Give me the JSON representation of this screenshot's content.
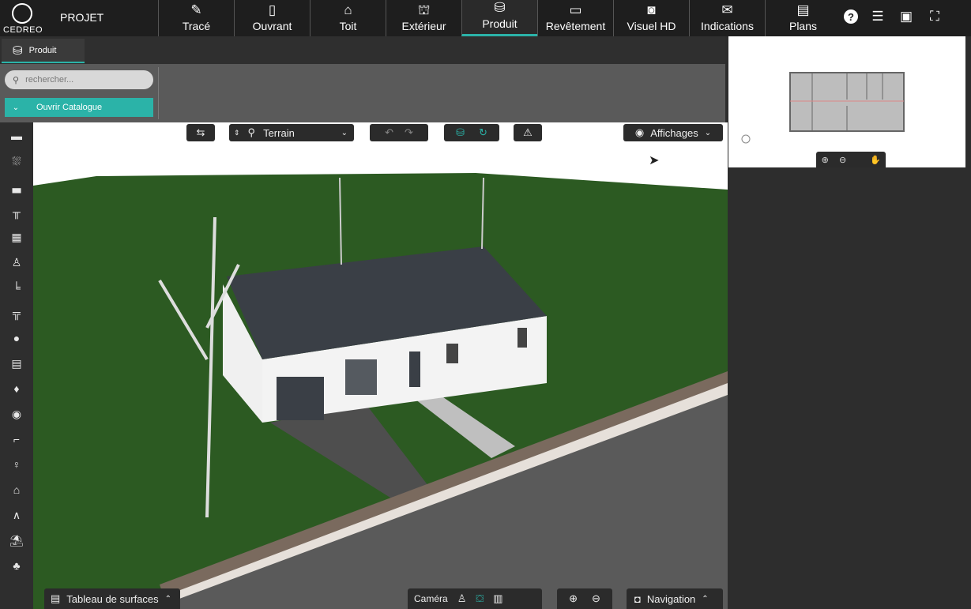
{
  "app": {
    "logo_text": "CEDREO",
    "project_label": "PROJET"
  },
  "nav": {
    "tabs": [
      {
        "label": "Tracé",
        "icon": "pencil-icon"
      },
      {
        "label": "Ouvrant",
        "icon": "door-icon"
      },
      {
        "label": "Toit",
        "icon": "roof-icon"
      },
      {
        "label": "Extérieur",
        "icon": "exterior-icon"
      },
      {
        "label": "Produit",
        "icon": "product-icon",
        "active": true
      },
      {
        "label": "Revêtement",
        "icon": "paint-roller-icon"
      },
      {
        "label": "Visuel HD",
        "icon": "camera-icon"
      },
      {
        "label": "Indications",
        "icon": "indications-icon"
      },
      {
        "label": "Plans",
        "icon": "plans-icon"
      }
    ],
    "right_icons": [
      "help-icon",
      "comment-icon",
      "save-icon",
      "fullscreen-icon"
    ]
  },
  "subtab": {
    "label": "Produit"
  },
  "catalog": {
    "search_placeholder": "rechercher...",
    "open_label": "Ouvrir Catalogue"
  },
  "sidebar": {
    "icons": [
      "kitchen-icon",
      "bathroom-icon",
      "living-room-icon",
      "dining-icon",
      "storage-icon",
      "toilet-icon",
      "bed-icon",
      "office-icon",
      "sport-icon",
      "appliance-icon",
      "lighting-icon",
      "decoration-icon",
      "stairs-icon",
      "character-icon",
      "house-icon",
      "roof-element-icon",
      "garden-furniture-icon",
      "vegetation-icon"
    ]
  },
  "viewport_toolbar": {
    "level": "Terrain",
    "display": "Affichages"
  },
  "bottom_bar": {
    "surfaces": "Tableau de surfaces",
    "camera": "Caméra",
    "navigation": "Navigation"
  },
  "colors": {
    "accent": "#2bb3a8",
    "topbar": "#1e1e1e",
    "grass": "#2a5a1e",
    "road": "#555555",
    "roof": "#3a3f46"
  }
}
